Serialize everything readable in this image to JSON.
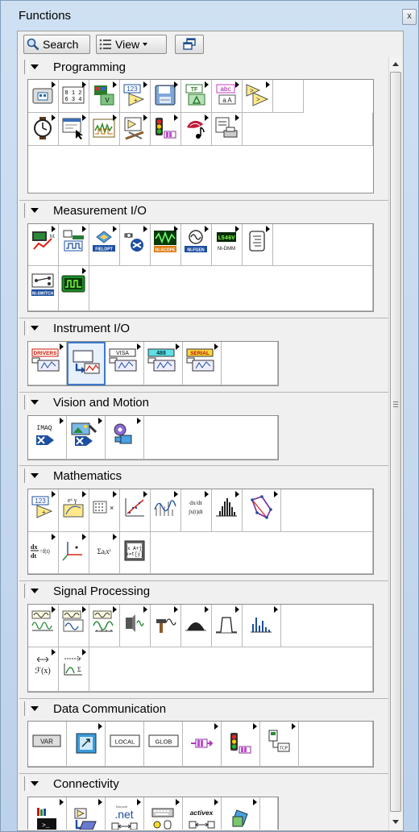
{
  "window": {
    "title": "Functions",
    "close_glyph": "x"
  },
  "toolbar": {
    "search_label": "Search",
    "view_label": "View"
  },
  "sections": [
    {
      "label": "Programming",
      "icons": [
        "structures",
        "array",
        "cluster-class-variant",
        "numeric",
        "file-io",
        "boolean",
        "string",
        "comparison",
        "timing",
        "dialog-ui",
        "waveform",
        "application-control",
        "synchronization",
        "graphics-sound",
        "report-generation"
      ]
    },
    {
      "label": "Measurement I/O",
      "icons": [
        "daqmx",
        "ni-scan",
        "fieldpoint",
        "imaq-dx",
        "ni-scope",
        "ni-fgen",
        "ni-dmm",
        "ni-swith-express",
        "ni-switch",
        "ni-hsdio"
      ]
    },
    {
      "label": "Instrument I/O",
      "icons": [
        "instrument-drivers",
        "instrument-io-assistant",
        "visa",
        "gpib",
        "serial"
      ]
    },
    {
      "label": "Vision and Motion",
      "icons": [
        "imaq",
        "vision-utilities",
        "motion"
      ]
    },
    {
      "label": "Mathematics",
      "icons": [
        "numeric-math",
        "elementary",
        "linear-algebra",
        "fitting",
        "interpolation",
        "integration-differentiation",
        "probability-statistics",
        "optimization",
        "differential-equations",
        "geometry",
        "polynomial",
        "scripts-formulas"
      ]
    },
    {
      "label": "Signal Processing",
      "icons": [
        "waveform-generation",
        "waveform-conditioning",
        "waveform-measurement",
        "signal-generation",
        "signal-operation",
        "windows",
        "filters",
        "spectral-analysis",
        "transforms",
        "point-by-point"
      ]
    },
    {
      "label": "Data Communication",
      "icons": [
        "shared-variable",
        "datasocket",
        "local-variable",
        "global-variable",
        "queue-notifier",
        "synchronization-dc",
        "protocols"
      ]
    },
    {
      "label": "Connectivity",
      "icons": [
        "libraries-executables",
        "input-device-control",
        "dotnet",
        "windows-registry",
        "activex",
        "source-control"
      ]
    }
  ],
  "icon_text": {
    "array_nums": "8 1 2 6 3 4",
    "numeric": "123",
    "boolean": "TF",
    "string": "abc",
    "daqmx": "MX",
    "fieldpoint": "FIELDPT",
    "ni-scope": "NI-SCOPE",
    "ni-fgen": "NI-FGEN",
    "ni-dmm_top": "L546V",
    "ni-dmm": "NI-DMM",
    "ni-switch": "NI-SWITCH",
    "instrument-drivers": "DRIVERS",
    "visa": "VISA",
    "gpib": "488",
    "serial": "SERIAL",
    "imaq": "IMAQ",
    "numeric-math": "123",
    "integration-top": "dx/dt",
    "integration-bottom": "∫x(t)dt",
    "differential-equations": "dx/dt=f(t)",
    "polynomial": "Σaᵢxⁱ",
    "transforms": "ℱ(x)",
    "shared-variable": "VAR",
    "local-variable": "LOCAL",
    "global-variable": "GLOB",
    "protocols": "TCP",
    "dotnet": ".net",
    "dotnet_sub": "Microsoft",
    "activex": "activex"
  }
}
